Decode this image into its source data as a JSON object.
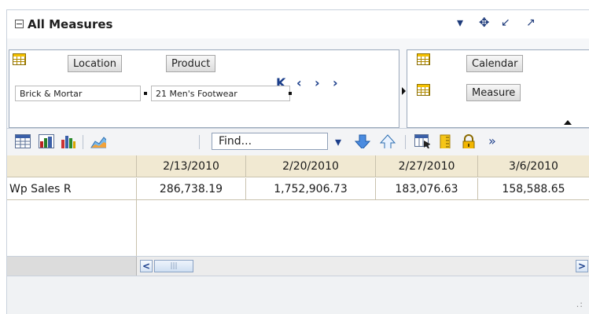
{
  "header": {
    "title": "All Measures"
  },
  "pivot": {
    "location_label": "Location",
    "product_label": "Product",
    "location_value": "Brick & Mortar",
    "product_value": "21 Men's Footwear",
    "calendar_label": "Calendar",
    "measure_label": "Measure",
    "nav_icons": [
      "first-icon",
      "previous-icon",
      "next-icon",
      "last-icon"
    ]
  },
  "toolbar": {
    "find_placeholder": "Find...",
    "more_label": "»"
  },
  "grid": {
    "columns": [
      "2/13/2010",
      "2/20/2010",
      "2/27/2010",
      "3/6/2010"
    ],
    "rows": [
      {
        "label": "Wp Sales R",
        "values": [
          "286,738.19",
          "1,752,906.73",
          "183,076.63",
          "158,588.65"
        ]
      }
    ]
  },
  "colors": {
    "header_bg": "#f1e9d2",
    "accent_blue": "#1a3d8a",
    "icon_gold": "#f6c200"
  }
}
